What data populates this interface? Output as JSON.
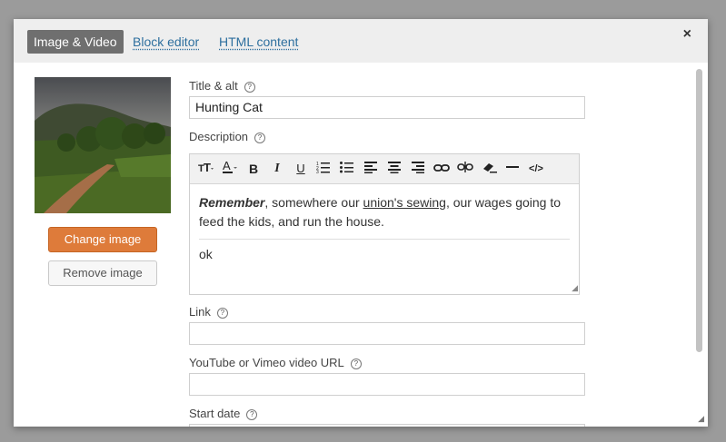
{
  "tabs": {
    "active": "Image & Video",
    "block_editor": "Block editor",
    "html_content": "HTML content"
  },
  "close_label": "×",
  "image": {
    "alt": "Hunting Cat"
  },
  "buttons": {
    "change": "Change image",
    "remove": "Remove image"
  },
  "fields": {
    "title_label": "Title & alt",
    "title_value": "Hunting Cat",
    "description_label": "Description",
    "link_label": "Link",
    "link_value": "",
    "video_label": "YouTube or Vimeo video URL",
    "video_value": "",
    "start_date_label": "Start date"
  },
  "description": {
    "bold_italic": "Remember",
    "text1": ", somewhere our ",
    "underlined": "union's sewing",
    "text2": ", our wages going to feed the kids, and run the house.",
    "second_paragraph": "ok"
  },
  "help_glyph": "?",
  "icons": [
    "text-size-icon",
    "font-color-icon",
    "bold-icon",
    "italic-icon",
    "underline-icon",
    "ordered-list-icon",
    "unordered-list-icon",
    "align-left-icon",
    "align-center-icon",
    "align-right-icon",
    "link-icon",
    "unlink-icon",
    "clear-format-icon",
    "horizontal-rule-icon",
    "code-view-icon"
  ],
  "colors": {
    "accent": "#de7b3a",
    "link": "#2d6f9e",
    "active_tab": "#6f6f6f"
  }
}
